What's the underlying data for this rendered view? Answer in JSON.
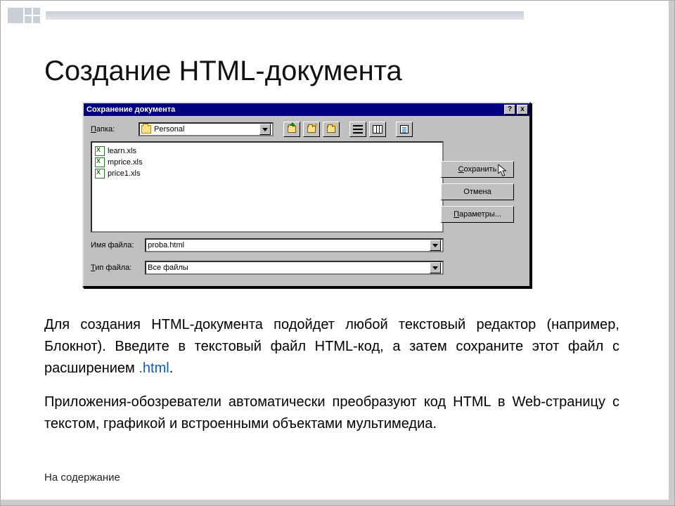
{
  "slide": {
    "title": "Создание HTML-документа",
    "toc_link": "На содержание"
  },
  "dialog": {
    "title": "Сохранение документа",
    "controls": {
      "help": "?",
      "close": "x"
    },
    "folder_label_pre": "П",
    "folder_label_post": "апка:",
    "folder_value": "Personal",
    "toolbar": {
      "up": "up-one-level",
      "desktop": "desktop",
      "new": "create-new-folder",
      "list": "list-view",
      "details": "details-view",
      "props": "properties"
    },
    "files": [
      {
        "name": "learn.xls"
      },
      {
        "name": "mprice.xls"
      },
      {
        "name": "price1.xls"
      }
    ],
    "filename_label_pre": "Имя файла:",
    "filename_value": "proba.html",
    "filetype_label_pre": "Т",
    "filetype_label_post": "ип файла:",
    "filetype_value": "Все файлы",
    "buttons": {
      "save_ul": "С",
      "save_rest": "охранить",
      "cancel": "Отмена",
      "params_ul": "П",
      "params_rest": "араметры..."
    }
  },
  "paragraphs": {
    "p1a": "Для создания HTML-документа подойдет любой текстовый редактор (например, Блокнот). Введите в текстовый файл HTML-код, а затем сохраните этот файл с расширением ",
    "p1_hl": ".html",
    "p1b": ".",
    "p2": " Приложения-обозреватели автоматически преобразуют код HTML в Web-страницу с текстом, графикой и встроенными объектами мультимедиа."
  }
}
